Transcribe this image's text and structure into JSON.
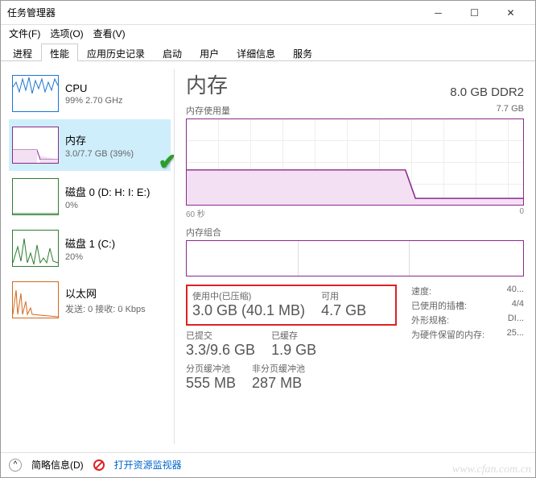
{
  "window": {
    "title": "任务管理器"
  },
  "menu": {
    "file": "文件(F)",
    "options": "选项(O)",
    "view": "查看(V)"
  },
  "tabs": [
    "进程",
    "性能",
    "应用历史记录",
    "启动",
    "用户",
    "详细信息",
    "服务"
  ],
  "sidebar": [
    {
      "title": "CPU",
      "sub": "99% 2.70 GHz"
    },
    {
      "title": "内存",
      "sub": "3.0/7.7 GB (39%)"
    },
    {
      "title": "磁盘 0 (D: H: I: E:)",
      "sub": "0%"
    },
    {
      "title": "磁盘 1 (C:)",
      "sub": "20%"
    },
    {
      "title": "以太网",
      "sub": "发送: 0 接收: 0 Kbps"
    }
  ],
  "main": {
    "title": "内存",
    "capacity": "8.0 GB DDR2",
    "usage_label": "内存使用量",
    "usage_max": "7.7 GB",
    "axis_left": "60 秒",
    "axis_right": "0",
    "composition_label": "内存组合",
    "stats": {
      "inuse_label": "使用中(已压缩)",
      "inuse_value": "3.0 GB (40.1 MB)",
      "available_label": "可用",
      "available_value": "4.7 GB",
      "committed_label": "已提交",
      "committed_value": "3.3/9.6 GB",
      "cached_label": "已缓存",
      "cached_value": "1.9 GB",
      "paged_label": "分页缓冲池",
      "paged_value": "555 MB",
      "nonpaged_label": "非分页缓冲池",
      "nonpaged_value": "287 MB"
    },
    "info": {
      "speed_label": "速度:",
      "speed": "40...",
      "slots_label": "已使用的插槽:",
      "slots": "4/4",
      "form_label": "外形规格:",
      "form": "DI...",
      "reserved_label": "为硬件保留的内存:",
      "reserved": "25..."
    }
  },
  "bottom": {
    "brief": "简略信息(D)",
    "monitor": "打开资源监视器"
  },
  "watermark": "www.cfan.com.cn",
  "chart_data": {
    "type": "area",
    "title": "内存使用量",
    "xlabel": "60 秒",
    "ylabel": "",
    "ylim": [
      0,
      7.7
    ],
    "x": [
      0,
      5,
      10,
      15,
      20,
      25,
      30,
      35,
      40,
      45,
      50,
      55,
      60
    ],
    "values": [
      3.0,
      3.0,
      3.0,
      3.0,
      3.0,
      3.0,
      3.0,
      3.0,
      3.0,
      3.0,
      0.3,
      0.3,
      0.3
    ]
  }
}
